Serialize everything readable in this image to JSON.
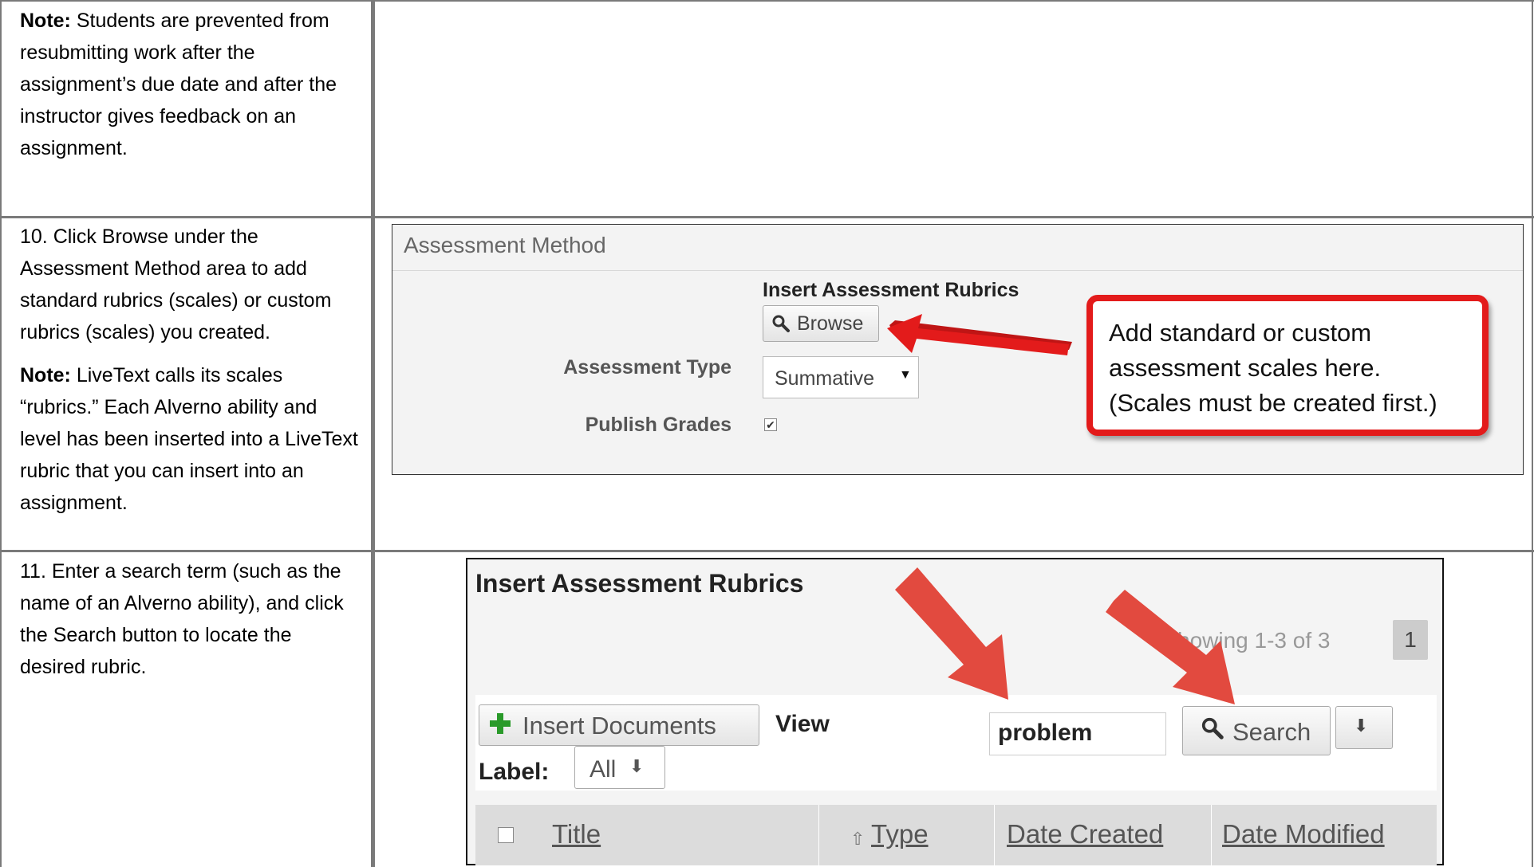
{
  "rows": [
    {
      "note_label": "Note:",
      "note_text": "Students are prevented from resubmitting work after the assignment’s due date and after the instructor gives feedback on an assignment."
    },
    {
      "step_text": "10. Click Browse under the Assessment Method area to add standard rubrics (scales) or custom rubrics (scales) you created.",
      "note_label": "Note:",
      "note_text": "LiveText calls its scales “rubrics.” Each Alverno ability and level has been inserted into a LiveText rubric that you can insert into an assignment."
    },
    {
      "step_text": "11. Enter a search term (such as the name of an Alverno ability), and click the Search button to locate the desired rubric."
    }
  ],
  "assessment_panel": {
    "title": "Assessment Method",
    "insert_label": "Insert Assessment Rubrics",
    "browse_label": "Browse",
    "type_label": "Assessment Type",
    "type_value": "Summative",
    "publish_label": "Publish Grades",
    "publish_checked": true
  },
  "callout": {
    "line1": "Add standard or custom",
    "line2": "assessment scales here.",
    "line3": "(Scales must be created first.)"
  },
  "rubrics_dialog": {
    "title": "Insert Assessment Rubrics",
    "showing_text": "howing 1-3 of 3",
    "page_number": "1",
    "insert_documents_label": "Insert Documents",
    "view_label": "View",
    "label_label": "Label:",
    "label_value": "All",
    "search_value": "problem",
    "search_button_label": "Search",
    "columns": [
      "Title",
      "Type",
      "Date Created",
      "Date Modified"
    ]
  },
  "colors": {
    "callout_border": "#e31b1b",
    "arrow_red": "#e24a3f",
    "plus_green": "#2a9a2a"
  }
}
